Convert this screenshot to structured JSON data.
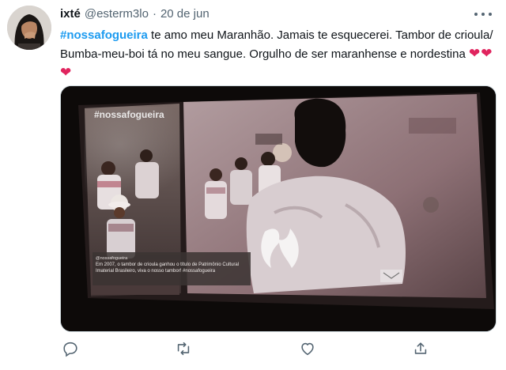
{
  "tweet": {
    "display_name": "ixté",
    "handle": "@esterm3lo",
    "separator": "·",
    "date": "20 de jun",
    "hashtag": "#nossafogueira",
    "body": " te amo meu Maranhão. Jamais te esquecerei. Tambor de crioula/ Bumba-meu-boi tá no meu sangue. Orgulho de ser maranhense e nordestina ",
    "emoji": "❤❤❤"
  },
  "media": {
    "overlay_hashtag": "#nossafogueira",
    "caption_handle": "@nossafogueira",
    "caption_text": "Em 2007, o tambor de crioula ganhou o título de Patrimônio Cultural Imaterial Brasileiro, viva o nosso tambor! #nossafogueira"
  },
  "colors": {
    "text": "#0f1419",
    "secondary": "#536471",
    "link": "#1d9bf0",
    "heart": "#e0245e"
  },
  "icons": [
    "more-icon",
    "reply-icon",
    "retweet-icon",
    "like-icon",
    "share-icon"
  ]
}
